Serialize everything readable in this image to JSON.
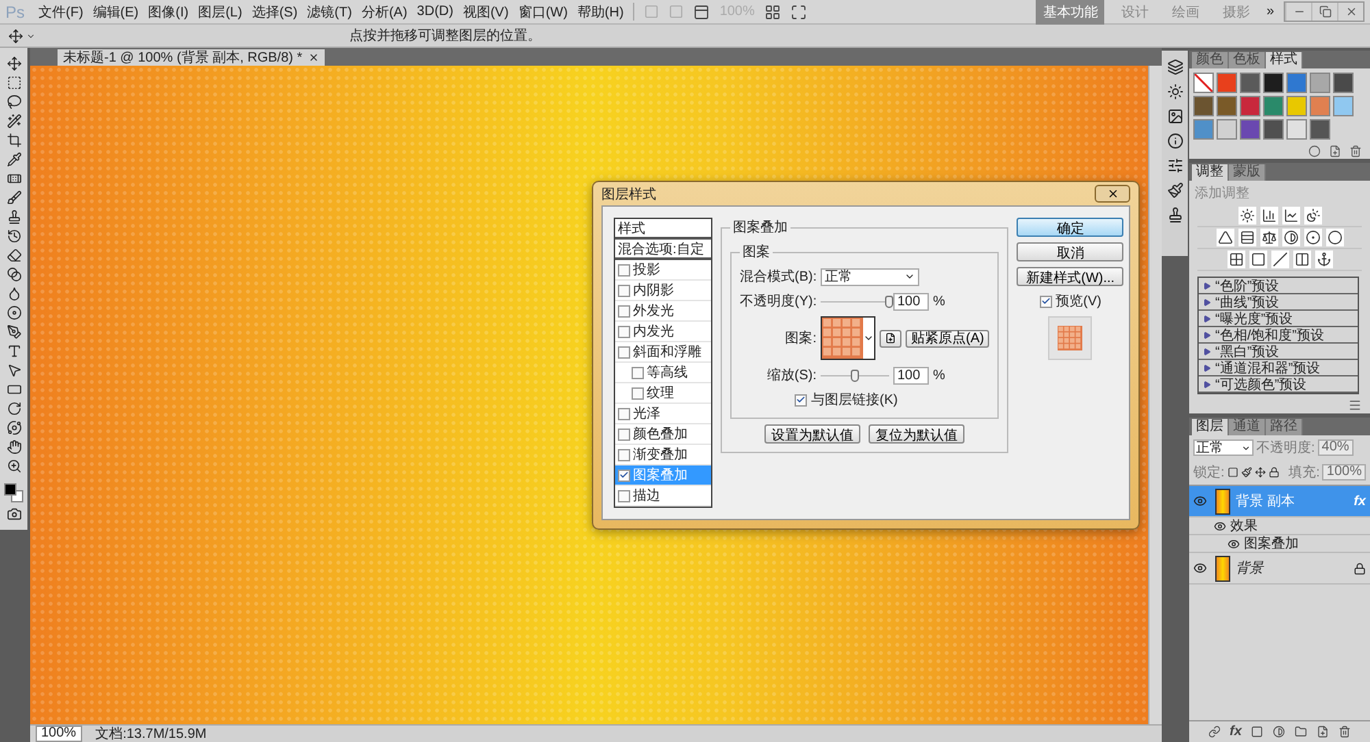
{
  "menu_bar": {
    "logo": "Ps",
    "items": [
      "文件(F)",
      "编辑(E)",
      "图像(I)",
      "图层(L)",
      "选择(S)",
      "滤镜(T)",
      "分析(A)",
      "3D(D)",
      "视图(V)",
      "窗口(W)",
      "帮助(H)"
    ],
    "zoom": "100%",
    "workspaces": [
      {
        "label": "基本功能",
        "selected": true
      },
      {
        "label": "设计",
        "selected": false
      },
      {
        "label": "绘画",
        "selected": false
      },
      {
        "label": "摄影",
        "selected": false
      }
    ],
    "more": "»"
  },
  "options_bar": {
    "hint": "点按并拖移可调整图层的位置。"
  },
  "document": {
    "tab": "未标题-1 @ 100% (背景 副本, RGB/8) *"
  },
  "dialog": {
    "title": "图层样式",
    "styles_list": [
      {
        "label": "样式",
        "kind": "header",
        "selected": false
      },
      {
        "label": "混合选项:自定",
        "kind": "header",
        "selected": false
      },
      {
        "label": "投影",
        "kind": "effect",
        "checked": false,
        "selected": false
      },
      {
        "label": "内阴影",
        "kind": "effect",
        "checked": false,
        "selected": false
      },
      {
        "label": "外发光",
        "kind": "effect",
        "checked": false,
        "selected": false
      },
      {
        "label": "内发光",
        "kind": "effect",
        "checked": false,
        "selected": false
      },
      {
        "label": "斜面和浮雕",
        "kind": "effect",
        "checked": false,
        "selected": false,
        "children": [
          {
            "label": "等高线",
            "kind": "effect",
            "checked": false,
            "selected": false
          },
          {
            "label": "纹理",
            "kind": "effect",
            "checked": false,
            "selected": false
          }
        ]
      },
      {
        "label": "光泽",
        "kind": "effect",
        "checked": false,
        "selected": false
      },
      {
        "label": "颜色叠加",
        "kind": "effect",
        "checked": false,
        "selected": false
      },
      {
        "label": "渐变叠加",
        "kind": "effect",
        "checked": false,
        "selected": false
      },
      {
        "label": "图案叠加",
        "kind": "effect",
        "checked": true,
        "selected": true
      },
      {
        "label": "描边",
        "kind": "effect",
        "checked": false,
        "selected": false
      }
    ],
    "group_title": "图案叠加",
    "subgroup_title": "图案",
    "blend_label": "混合模式(B):",
    "blend_value": "正常",
    "opacity_label": "不透明度(Y):",
    "opacity_slider": {
      "level": 1
    },
    "opacity_value": "100",
    "opacity_unit": "%",
    "pattern_label": "图案:",
    "snap_button": "贴紧原点(A)",
    "scale_label": "缩放(S):",
    "scale_slider": {
      "level": 0.5
    },
    "scale_value": "100",
    "scale_unit": "%",
    "link": {
      "label": "与图层链接(K)",
      "checked": true
    },
    "default_buttons": [
      "设置为默认值",
      "复位为默认值"
    ],
    "ok": "确定",
    "cancel": "取消",
    "new_style": "新建样式(W)...",
    "preview": {
      "label": "预览(V)",
      "checked": true
    }
  },
  "styles_panel": {
    "tabs": [
      {
        "label": "颜色",
        "selected": false
      },
      {
        "label": "色板",
        "selected": false
      },
      {
        "label": "样式",
        "selected": true
      }
    ],
    "swatches": [
      {
        "kind": "none",
        "color": "#ffffff"
      },
      {
        "kind": "fill",
        "color": "#e8401c"
      },
      {
        "kind": "fill",
        "color": "#5a5a5a"
      },
      {
        "kind": "fill",
        "color": "#1e1e1e"
      },
      {
        "kind": "fill",
        "color": "#2f78d0"
      },
      {
        "kind": "fill",
        "color": "#a8a8a8"
      },
      {
        "kind": "fill",
        "color": "#4a4a4a"
      },
      {
        "kind": "fill",
        "color": "#6b5430"
      },
      {
        "kind": "fill",
        "color": "#7a5a28"
      },
      {
        "kind": "fill",
        "color": "#c8283c"
      },
      {
        "kind": "fill",
        "color": "#2a8a6a"
      },
      {
        "kind": "fill",
        "color": "#e8c800"
      },
      {
        "kind": "fill",
        "color": "#e08050"
      },
      {
        "kind": "fill",
        "color": "#90c8f0"
      },
      {
        "kind": "fill",
        "color": "#5090c8"
      },
      {
        "kind": "fill",
        "color": "#d0d0d0"
      },
      {
        "kind": "fill",
        "color": "#6a48b0"
      },
      {
        "kind": "fill",
        "color": "#505050"
      },
      {
        "kind": "fill",
        "color": "#e0e0e0"
      },
      {
        "kind": "fill",
        "color": "#555555"
      }
    ]
  },
  "adjustments_panel": {
    "tabs": [
      {
        "label": "调整",
        "selected": true
      },
      {
        "label": "蒙版",
        "selected": false
      }
    ],
    "heading": "添加调整",
    "presets": [
      "“色阶”预设",
      "“曲线”预设",
      "“曝光度”预设",
      "“色相/饱和度”预设",
      "“黑白”预设",
      "“通道混和器”预设",
      "“可选颜色”预设"
    ]
  },
  "layers_panel": {
    "tabs": [
      {
        "label": "图层",
        "selected": true
      },
      {
        "label": "通道",
        "selected": false
      },
      {
        "label": "路径",
        "selected": false
      }
    ],
    "blend_mode": "正常",
    "opacity_label": "不透明度:",
    "opacity": "40%",
    "lock_label": "锁定:",
    "fill_label": "填充:",
    "fill": "100%",
    "layers": [
      {
        "name": "背景 副本",
        "selected": true,
        "visible": true,
        "locked": false,
        "fx": "fx",
        "children": [
          {
            "name": "效果",
            "children": [
              {
                "name": "图案叠加"
              }
            ]
          }
        ]
      },
      {
        "name": "背景",
        "selected": false,
        "visible": true,
        "locked": true
      }
    ],
    "footer_fx": "fx"
  },
  "status_bar": {
    "zoom": "100%",
    "doc_info": "文档:13.7M/15.9M"
  }
}
